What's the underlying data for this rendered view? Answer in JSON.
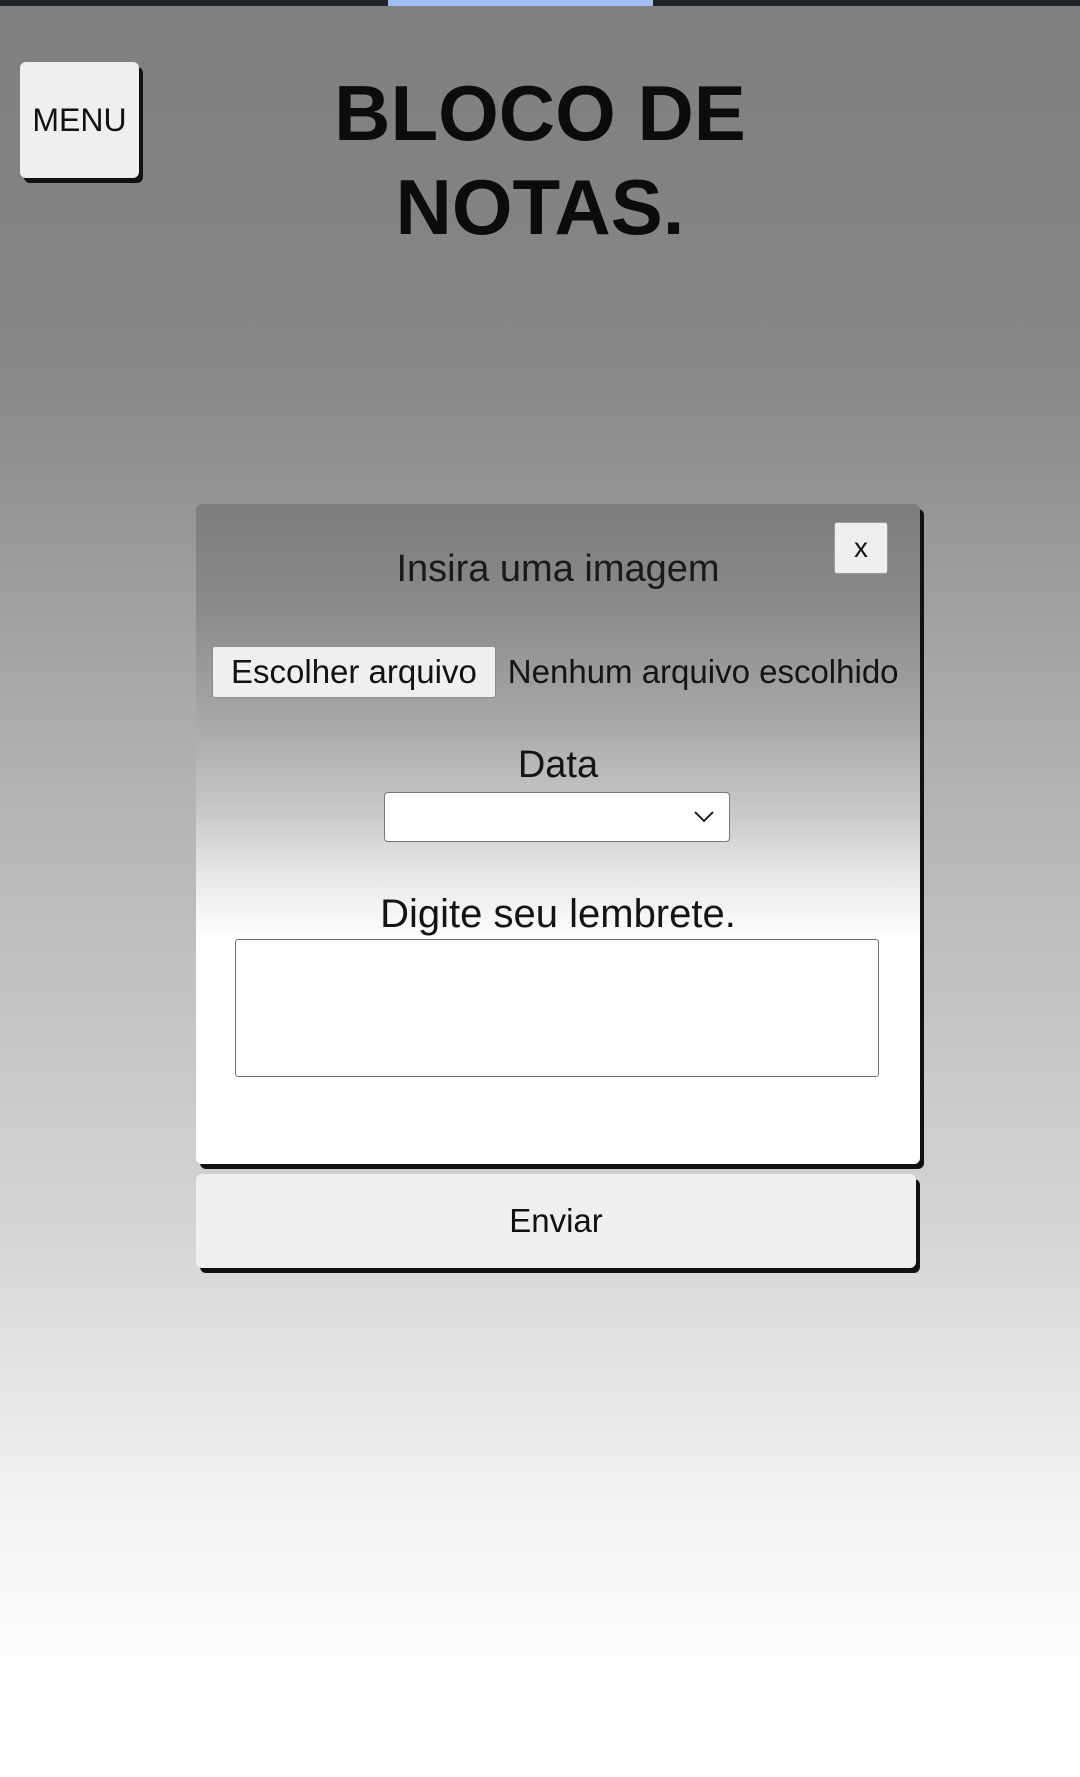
{
  "header": {
    "menu_label": "MENU",
    "title": "BLOCO DE NOTAS."
  },
  "modal": {
    "close_label": "x",
    "image_label": "Insira uma imagem",
    "file_button_label": "Escolher arquivo",
    "file_status": "Nenhum arquivo escolhido",
    "date_label": "Data",
    "date_value": "",
    "reminder_label": "Digite seu lembrete.",
    "reminder_value": ""
  },
  "submit_label": "Enviar",
  "colors": {
    "status_bar": "#1f2428",
    "status_indicator": "#9fbff2",
    "button_face": "#efefef",
    "shadow": "#111111"
  },
  "icons": {
    "select_arrow": "chevron-down-icon"
  }
}
